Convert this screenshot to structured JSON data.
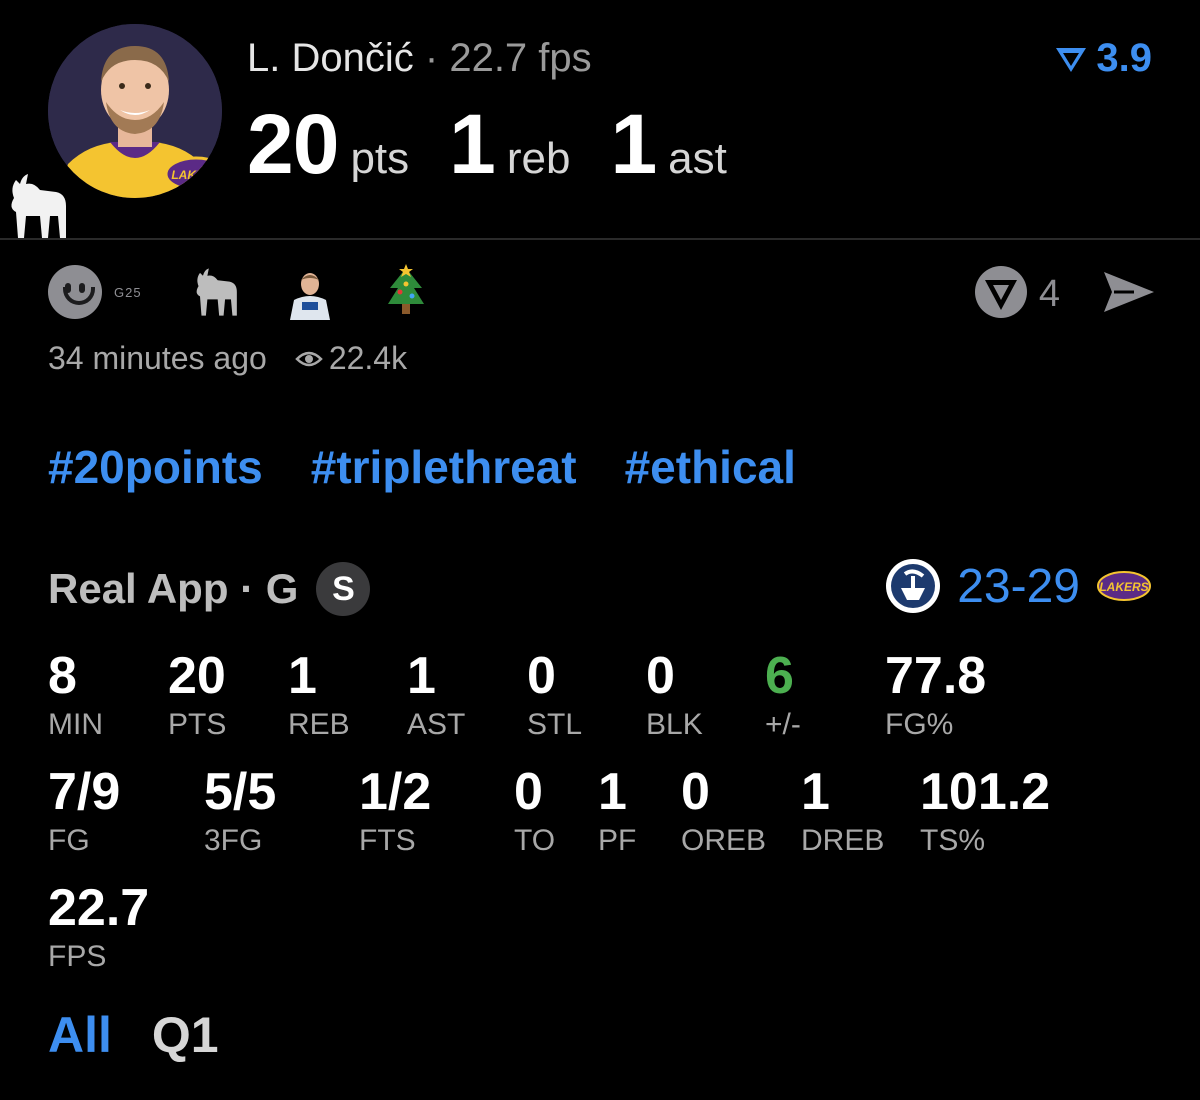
{
  "player": {
    "name": "L. Dončić",
    "separator": "·",
    "fps_text": "22.7 fps",
    "team_logo_text": "LAKERS",
    "points": "20",
    "points_unit": "pts",
    "rebounds": "1",
    "rebounds_unit": "reb",
    "assists": "1",
    "assists_unit": "ast"
  },
  "rating": {
    "value": "3.9",
    "icon": "v-triangle-icon"
  },
  "reactions": {
    "smile_icon": "smile-face-icon",
    "tag_text": "G25",
    "emojis": [
      "goat-icon",
      "player-thumbnail",
      "christmas-tree-icon"
    ],
    "count": "4",
    "action_icons": [
      "v-shield-icon",
      "send-icon"
    ]
  },
  "meta": {
    "time": "34 minutes ago",
    "views": "22.4k"
  },
  "hashtags": [
    "#20points",
    "#triplethreat",
    "#ethical"
  ],
  "game": {
    "source": "Real App · G",
    "badge": "S",
    "score": "23-29",
    "left_logo": "clippers-logo",
    "right_logo_text": "LAKERS"
  },
  "stats_row1": [
    {
      "value": "8",
      "label": "MIN"
    },
    {
      "value": "20",
      "label": "PTS"
    },
    {
      "value": "1",
      "label": "REB"
    },
    {
      "value": "1",
      "label": "AST"
    },
    {
      "value": "0",
      "label": "STL"
    },
    {
      "value": "0",
      "label": "BLK"
    },
    {
      "value": "6",
      "label": "+/-"
    },
    {
      "value": "77.8",
      "label": "FG%"
    }
  ],
  "stats_row2": [
    {
      "value": "7/9",
      "label": "FG"
    },
    {
      "value": "5/5",
      "label": "3FG"
    },
    {
      "value": "1/2",
      "label": "FTS"
    },
    {
      "value": "0",
      "label": "TO"
    },
    {
      "value": "1",
      "label": "PF"
    },
    {
      "value": "0",
      "label": "OREB"
    },
    {
      "value": "1",
      "label": "DREB"
    },
    {
      "value": "101.2",
      "label": "TS%"
    }
  ],
  "stats_row3": [
    {
      "value": "22.7",
      "label": "FPS"
    }
  ],
  "tabs": [
    "All",
    "Q1"
  ],
  "colors": {
    "accent": "#3d8ef0",
    "positive": "#4caf50",
    "muted": "#a8a8a8"
  }
}
